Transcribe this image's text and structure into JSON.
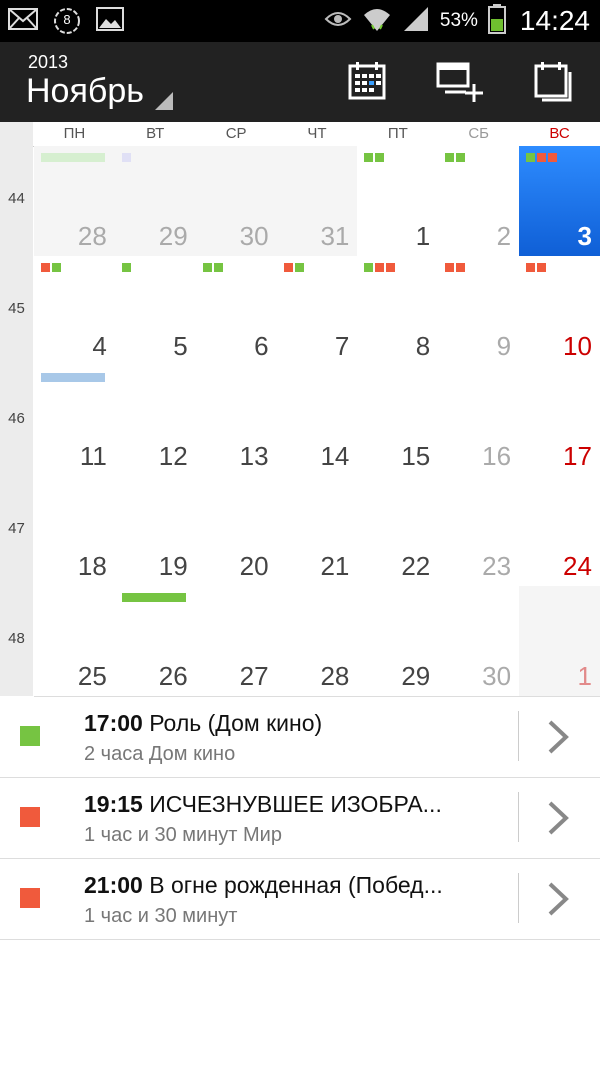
{
  "status_bar": {
    "battery_percent": "53%",
    "time": "14:24",
    "icons": [
      "mail-icon",
      "notification-badge-icon",
      "image-icon",
      "eye-icon",
      "wifi-icon",
      "signal-icon",
      "battery-icon"
    ],
    "badge_number": "8"
  },
  "action_bar": {
    "year": "2013",
    "month": "Ноябрь",
    "buttons": [
      "calendar-grid-icon",
      "add-event-icon",
      "today-icon"
    ]
  },
  "weekdays": [
    "ПН",
    "ВТ",
    "СР",
    "ЧТ",
    "ПТ",
    "СБ",
    "ВС"
  ],
  "weeks": [
    {
      "num": "44",
      "days": [
        {
          "d": "28",
          "other": true,
          "marks": [
            {
              "bar": "#d6efd0",
              "w": 64
            }
          ]
        },
        {
          "d": "29",
          "other": true,
          "marks": [
            {
              "dots": [
                "#e0e0f5"
              ]
            }
          ]
        },
        {
          "d": "30",
          "other": true,
          "marks": []
        },
        {
          "d": "31",
          "other": true,
          "marks": []
        },
        {
          "d": "1",
          "marks": [
            {
              "dots": [
                "#76c442",
                "#76c442"
              ]
            }
          ]
        },
        {
          "d": "2",
          "sat": true,
          "marks": [
            {
              "dots": [
                "#76c442",
                "#76c442"
              ]
            }
          ]
        },
        {
          "d": "3",
          "sun": true,
          "today": true,
          "marks": [
            {
              "dots": [
                "#76c442",
                "#f05a3c",
                "#f05a3c"
              ]
            }
          ]
        }
      ]
    },
    {
      "num": "45",
      "days": [
        {
          "d": "4",
          "marks": [
            {
              "dots": [
                "#f05a3c",
                "#76c442"
              ]
            }
          ]
        },
        {
          "d": "5",
          "marks": [
            {
              "dots": [
                "#76c442"
              ]
            }
          ]
        },
        {
          "d": "6",
          "marks": [
            {
              "dots": [
                "#76c442",
                "#76c442"
              ]
            }
          ]
        },
        {
          "d": "7",
          "marks": [
            {
              "dots": [
                "#f05a3c",
                "#76c442"
              ]
            }
          ]
        },
        {
          "d": "8",
          "marks": [
            {
              "dots": [
                "#76c442",
                "#f05a3c",
                "#f05a3c"
              ]
            }
          ]
        },
        {
          "d": "9",
          "sat": true,
          "marks": [
            {
              "dots": [
                "#f05a3c",
                "#f05a3c"
              ]
            }
          ]
        },
        {
          "d": "10",
          "sun": true,
          "marks": [
            {
              "dots": [
                "#f05a3c",
                "#f05a3c"
              ]
            }
          ]
        }
      ]
    },
    {
      "num": "46",
      "days": [
        {
          "d": "11",
          "marks": [
            {
              "bar": "#a8c8e8",
              "w": 64
            }
          ]
        },
        {
          "d": "12",
          "marks": []
        },
        {
          "d": "13",
          "marks": []
        },
        {
          "d": "14",
          "marks": []
        },
        {
          "d": "15",
          "marks": []
        },
        {
          "d": "16",
          "sat": true,
          "marks": []
        },
        {
          "d": "17",
          "sun": true,
          "marks": []
        }
      ]
    },
    {
      "num": "47",
      "days": [
        {
          "d": "18",
          "marks": []
        },
        {
          "d": "19",
          "marks": []
        },
        {
          "d": "20",
          "marks": []
        },
        {
          "d": "21",
          "marks": []
        },
        {
          "d": "22",
          "marks": []
        },
        {
          "d": "23",
          "sat": true,
          "marks": []
        },
        {
          "d": "24",
          "sun": true,
          "marks": []
        }
      ]
    },
    {
      "num": "48",
      "days": [
        {
          "d": "25",
          "marks": []
        },
        {
          "d": "26",
          "marks": [
            {
              "bar": "#76c442",
              "w": 64
            }
          ]
        },
        {
          "d": "27",
          "marks": []
        },
        {
          "d": "28",
          "marks": []
        },
        {
          "d": "29",
          "marks": []
        },
        {
          "d": "30",
          "sat": true,
          "marks": []
        },
        {
          "d": "1",
          "sun": true,
          "other": true,
          "marks": []
        }
      ]
    }
  ],
  "events": [
    {
      "time": "17:00",
      "title": "Роль (Дом кино)",
      "sub": "2 часа Дом кино",
      "color": "#76c442"
    },
    {
      "time": "19:15",
      "title": "ИСЧЕЗНУВШЕЕ ИЗОБРА...",
      "sub": "1 час и 30 минут Мир",
      "color": "#f05a3c"
    },
    {
      "time": "21:00",
      "title": "В огне рожденная (Побед...",
      "sub": "1 час и 30 минут",
      "color": "#f05a3c"
    }
  ]
}
